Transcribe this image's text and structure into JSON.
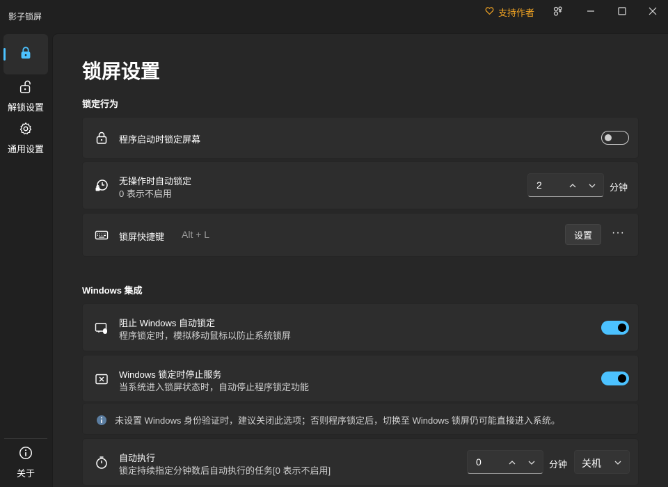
{
  "app": {
    "title": "影子锁屏",
    "support_label": "支持作者",
    "accent": "#4cc2ff",
    "support_color": "#f5a623"
  },
  "sidebar": {
    "items": [
      {
        "label": "",
        "icon": "lock-icon",
        "active": true
      },
      {
        "label": "解锁设置",
        "icon": "unlock-icon"
      },
      {
        "label": "通用设置",
        "icon": "gear-icon"
      }
    ],
    "footer": {
      "label": "关于",
      "icon": "info-icon"
    }
  },
  "main": {
    "page_title": "锁屏设置",
    "section_lock": "锁定行为",
    "section_windows": "Windows 集成",
    "lock_on_start": {
      "title": "程序启动时锁定屏幕",
      "enabled": false
    },
    "idle_lock": {
      "title": "无操作时自动锁定",
      "desc": "0 表示不启用",
      "value": "2",
      "unit": "分钟"
    },
    "hotkey": {
      "title": "锁屏快捷键",
      "value": "Alt + L",
      "set_label": "设置",
      "more_label": "···"
    },
    "block_win_lock": {
      "title": "阻止 Windows 自动锁定",
      "desc": "程序锁定时，模拟移动鼠标以防止系统锁屏",
      "enabled": true
    },
    "stop_on_win_lock": {
      "title": "Windows 锁定时停止服务",
      "desc": "当系统进入锁屏状态时，自动停止程序锁定功能",
      "enabled": true
    },
    "info_text": "未设置 Windows 身份验证时，建议关闭此选项；否则程序锁定后，切换至 Windows 锁屏仍可能直接进入系统。",
    "auto_exec": {
      "title": "自动执行",
      "desc": "锁定持续指定分钟数后自动执行的任务[0 表示不启用]",
      "value": "0",
      "unit": "分钟",
      "action": "关机"
    }
  }
}
